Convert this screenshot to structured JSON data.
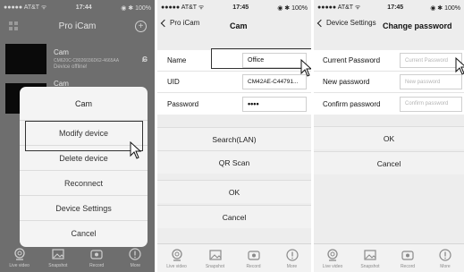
{
  "panel1": {
    "status": {
      "carrier": "●●●●● AT&T ᯤ",
      "time": "17:44",
      "right": "◉ ✱ 100%"
    },
    "title": "Pro iCam",
    "add_icon": "plus-icon",
    "menu_icon": "grid-icon",
    "cameras": [
      {
        "name": "Cam",
        "uid": "CM620C-C8026036D62-4665AA",
        "status": "Device offline!"
      },
      {
        "name": "Cam"
      }
    ],
    "sheet": {
      "title": "Cam",
      "items": [
        "Modify device",
        "Delete device",
        "Reconnect",
        "Device Settings",
        "Cancel"
      ]
    },
    "tabs": [
      "Live video",
      "Snapshot",
      "Record",
      "More"
    ]
  },
  "panel2": {
    "status": {
      "carrier": "●●●●● AT&T ᯤ",
      "time": "17:45",
      "right": "◉ ✱ 100%"
    },
    "back_label": "Pro iCam",
    "title": "Cam",
    "fields": {
      "name_label": "Name",
      "name_value": "Office",
      "uid_label": "UID",
      "uid_value": "CM42AE-C44791...",
      "password_label": "Password",
      "password_value": "••••"
    },
    "buttons": [
      "Search(LAN)",
      "QR Scan",
      "OK",
      "Cancel"
    ],
    "tabs": [
      "Live video",
      "Snapshot",
      "Record",
      "More"
    ]
  },
  "panel3": {
    "status": {
      "carrier": "●●●●● AT&T ᯤ",
      "time": "17:45",
      "right": "◉ ✱ 100%"
    },
    "back_label": "Device Settings",
    "title": "Change password",
    "fields": {
      "current_label": "Current Password",
      "current_placeholder": "Current Password",
      "new_label": "New password",
      "new_placeholder": "New password",
      "confirm_label": "Confirm password",
      "confirm_placeholder": "Confirm password"
    },
    "buttons": [
      "OK",
      "Cancel"
    ],
    "tabs": [
      "Live video",
      "Snapshot",
      "Record",
      "More"
    ]
  }
}
